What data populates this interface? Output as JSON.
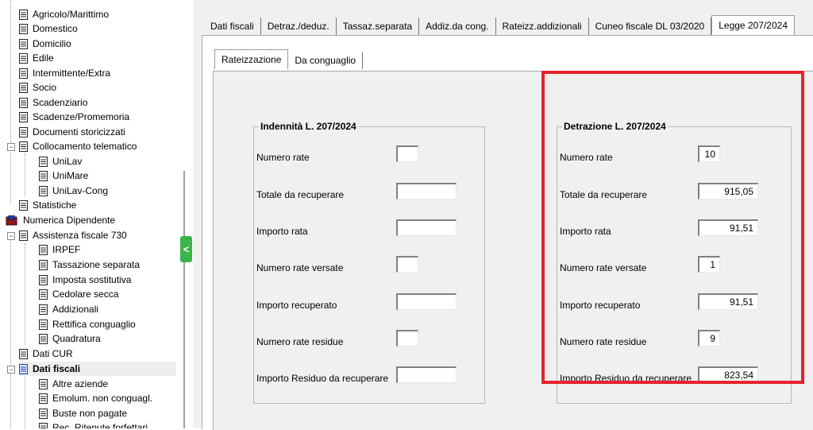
{
  "tree": {
    "items": [
      {
        "label": "Agricolo/Marittimo"
      },
      {
        "label": "Domestico"
      },
      {
        "label": "Domicilio"
      },
      {
        "label": "Edile"
      },
      {
        "label": "Intermittente/Extra"
      },
      {
        "label": "Socio"
      },
      {
        "label": "Scadenziario"
      },
      {
        "label": "Scadenze/Promemoria"
      },
      {
        "label": "Documenti storicizzati"
      },
      {
        "label": "Collocamento telematico"
      },
      {
        "label": "UniLav"
      },
      {
        "label": "UniMare"
      },
      {
        "label": "UniLav-Cong"
      },
      {
        "label": "Statistiche"
      },
      {
        "label": "Numerica Dipendente"
      },
      {
        "label": "Assistenza fiscale 730"
      },
      {
        "label": "IRPEF"
      },
      {
        "label": "Tassazione separata"
      },
      {
        "label": "Imposta sostitutiva"
      },
      {
        "label": "Cedolare secca"
      },
      {
        "label": "Addizionali"
      },
      {
        "label": "Rettifica conguaglio"
      },
      {
        "label": "Quadratura"
      },
      {
        "label": "Dati CUR"
      },
      {
        "label": "Dati fiscali"
      },
      {
        "label": "Altre aziende"
      },
      {
        "label": "Emolum. non conguagl."
      },
      {
        "label": "Buste non pagate"
      },
      {
        "label": "Rec. Ritenute forfettari"
      }
    ],
    "collapse_glyph": "<"
  },
  "tabs": {
    "outer": [
      "Dati fiscali",
      "Detraz./deduz.",
      "Tassaz.separata",
      "Addiz.da cong.",
      "Rateizz.addizionali",
      "Cuneo fiscale DL 03/2020",
      "Legge 207/2024"
    ],
    "outer_active": "Legge 207/2024",
    "inner": [
      "Rateizzazione",
      "Da conguaglio"
    ],
    "inner_active": "Rateizzazione"
  },
  "indennita": {
    "title": "Indennità L. 207/2024",
    "rows": [
      {
        "label": "Numero rate",
        "value": ""
      },
      {
        "label": "Totale da recuperare",
        "value": ""
      },
      {
        "label": "Importo rata",
        "value": ""
      },
      {
        "label": "Numero rate versate",
        "value": ""
      },
      {
        "label": "Importo recuperato",
        "value": ""
      },
      {
        "label": "Numero rate residue",
        "value": ""
      },
      {
        "label": "Importo Residuo da recuperare",
        "value": ""
      }
    ]
  },
  "detrazione": {
    "title": "Detrazione L. 207/2024",
    "rows": [
      {
        "label": "Numero rate",
        "value": "10"
      },
      {
        "label": "Totale da recuperare",
        "value": "915,05"
      },
      {
        "label": "Importo rata",
        "value": "91,51"
      },
      {
        "label": "Numero rate versate",
        "value": "1"
      },
      {
        "label": "Importo recuperato",
        "value": "91,51"
      },
      {
        "label": "Numero rate residue",
        "value": "9"
      },
      {
        "label": "Importo Residuo da recuperare",
        "value": "823,54"
      }
    ]
  },
  "colors": {
    "highlight": "#e3242b",
    "splitter_button": "#3bb44a"
  }
}
